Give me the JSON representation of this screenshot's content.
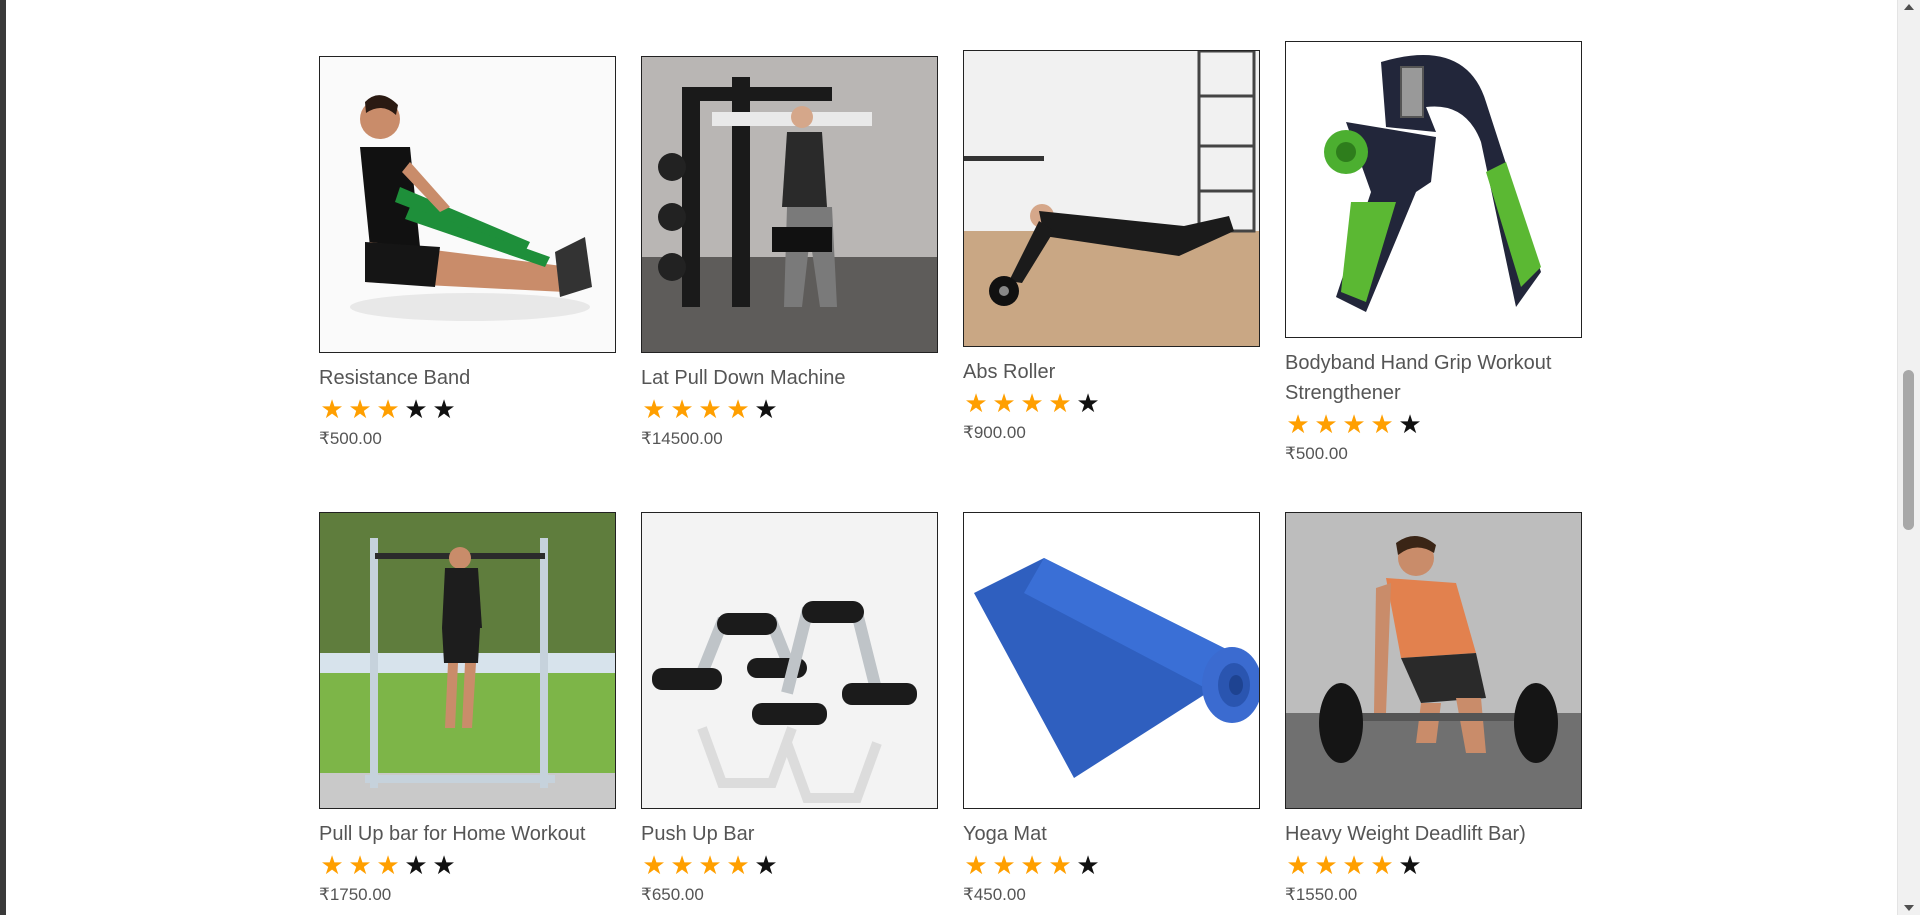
{
  "products": [
    {
      "name": "Resistance Band",
      "rating": 3,
      "max_rating": 5,
      "price": "₹500.00",
      "image": "man-resistance-band"
    },
    {
      "name": "Lat Pull Down Machine",
      "rating": 4,
      "max_rating": 5,
      "price": "₹14500.00",
      "image": "lat-pull-down-machine"
    },
    {
      "name": "Abs Roller",
      "rating": 4,
      "max_rating": 5,
      "price": "₹900.00",
      "image": "abs-roller"
    },
    {
      "name": "Bodyband Hand Grip Workout Strengthener",
      "rating": 4,
      "max_rating": 5,
      "price": "₹500.00",
      "image": "hand-grip"
    },
    {
      "name": "Pull Up bar for Home Workout",
      "rating": 3,
      "max_rating": 5,
      "price": "₹1750.00",
      "image": "pull-up-bar"
    },
    {
      "name": "Push Up Bar",
      "rating": 4,
      "max_rating": 5,
      "price": "₹650.00",
      "image": "push-up-bars"
    },
    {
      "name": "Yoga Mat",
      "rating": 4,
      "max_rating": 5,
      "price": "₹450.00",
      "image": "yoga-mat"
    },
    {
      "name": "Heavy Weight Deadlift Bar)",
      "rating": 4,
      "max_rating": 5,
      "price": "₹1550.00",
      "image": "deadlift-bar"
    }
  ],
  "colors": {
    "star_filled": "#ff9f00",
    "star_empty": "#111111",
    "text": "#555555"
  }
}
